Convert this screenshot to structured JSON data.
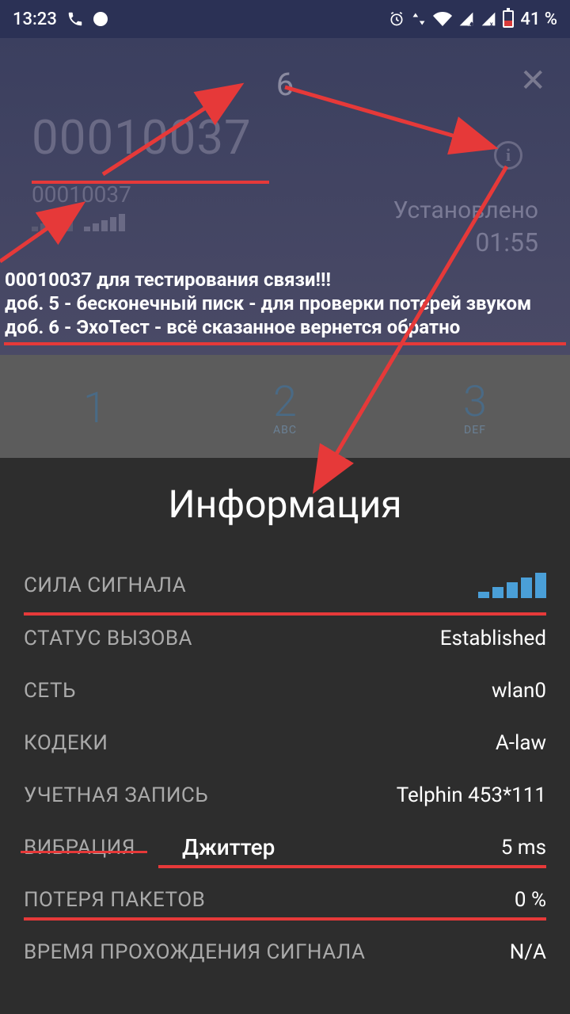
{
  "status": {
    "time": "13:23",
    "battery": "41 %"
  },
  "call": {
    "dtmf": "6",
    "number": "00010037",
    "number_small": "00010037",
    "status": "Установлено",
    "timer": "01:55"
  },
  "annotation": {
    "line1": "00010037 для тестирования связи!!!",
    "line2": "доб. 5 - бесконечный писк - для проверки потерей звуком",
    "line3": "доб. 6 - ЭхоТест - всё сказанное вернется обратно",
    "jitter_label": "Джиттер"
  },
  "dialpad": {
    "k1": {
      "n": "1",
      "l": ""
    },
    "k2": {
      "n": "2",
      "l": "ABC"
    },
    "k3": {
      "n": "3",
      "l": "DEF"
    }
  },
  "info": {
    "title": "Информация",
    "rows": [
      {
        "label": "СИЛА СИГНАЛА",
        "value": ""
      },
      {
        "label": "СТАТУС ВЫЗОВА",
        "value": "Established"
      },
      {
        "label": "СЕТЬ",
        "value": "wlan0"
      },
      {
        "label": "КОДЕКИ",
        "value": "A-law"
      },
      {
        "label": "УЧЕТНАЯ ЗАПИСЬ",
        "value": "Telphin 453*111"
      },
      {
        "label": "ВИБРАЦИЯ",
        "value": "5 ms"
      },
      {
        "label": "ПОТЕРЯ ПАКЕТОВ",
        "value": "0 %"
      },
      {
        "label": "ВРЕМЯ ПРОХОЖДЕНИЯ СИГНАЛА",
        "value": "N/A"
      }
    ]
  }
}
